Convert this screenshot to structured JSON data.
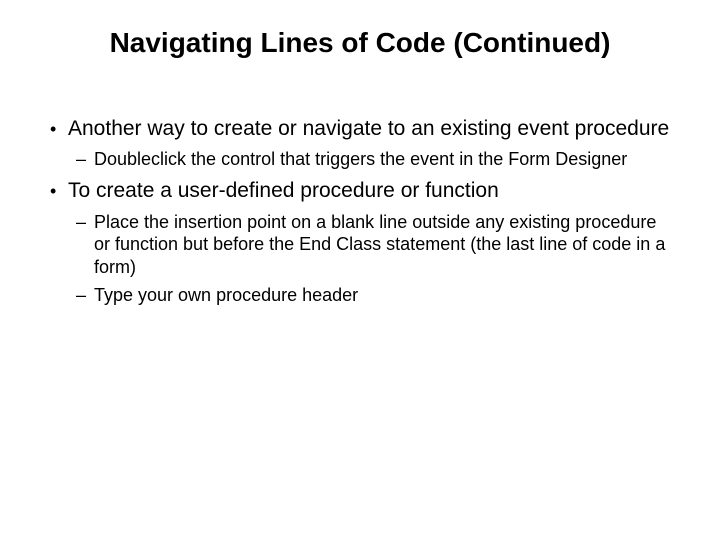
{
  "title": "Navigating Lines of Code (Continued)",
  "bullets": [
    {
      "text": "Another way to create or navigate to an existing event procedure",
      "sub": [
        "Doubleclick the control that triggers the event in the Form Designer"
      ]
    },
    {
      "text": "To create a user-defined procedure or function",
      "sub": [
        "Place the insertion point on a blank line outside any existing procedure or function but before the End Class statement (the last line of code in a form)",
        "Type your own procedure header"
      ]
    }
  ]
}
